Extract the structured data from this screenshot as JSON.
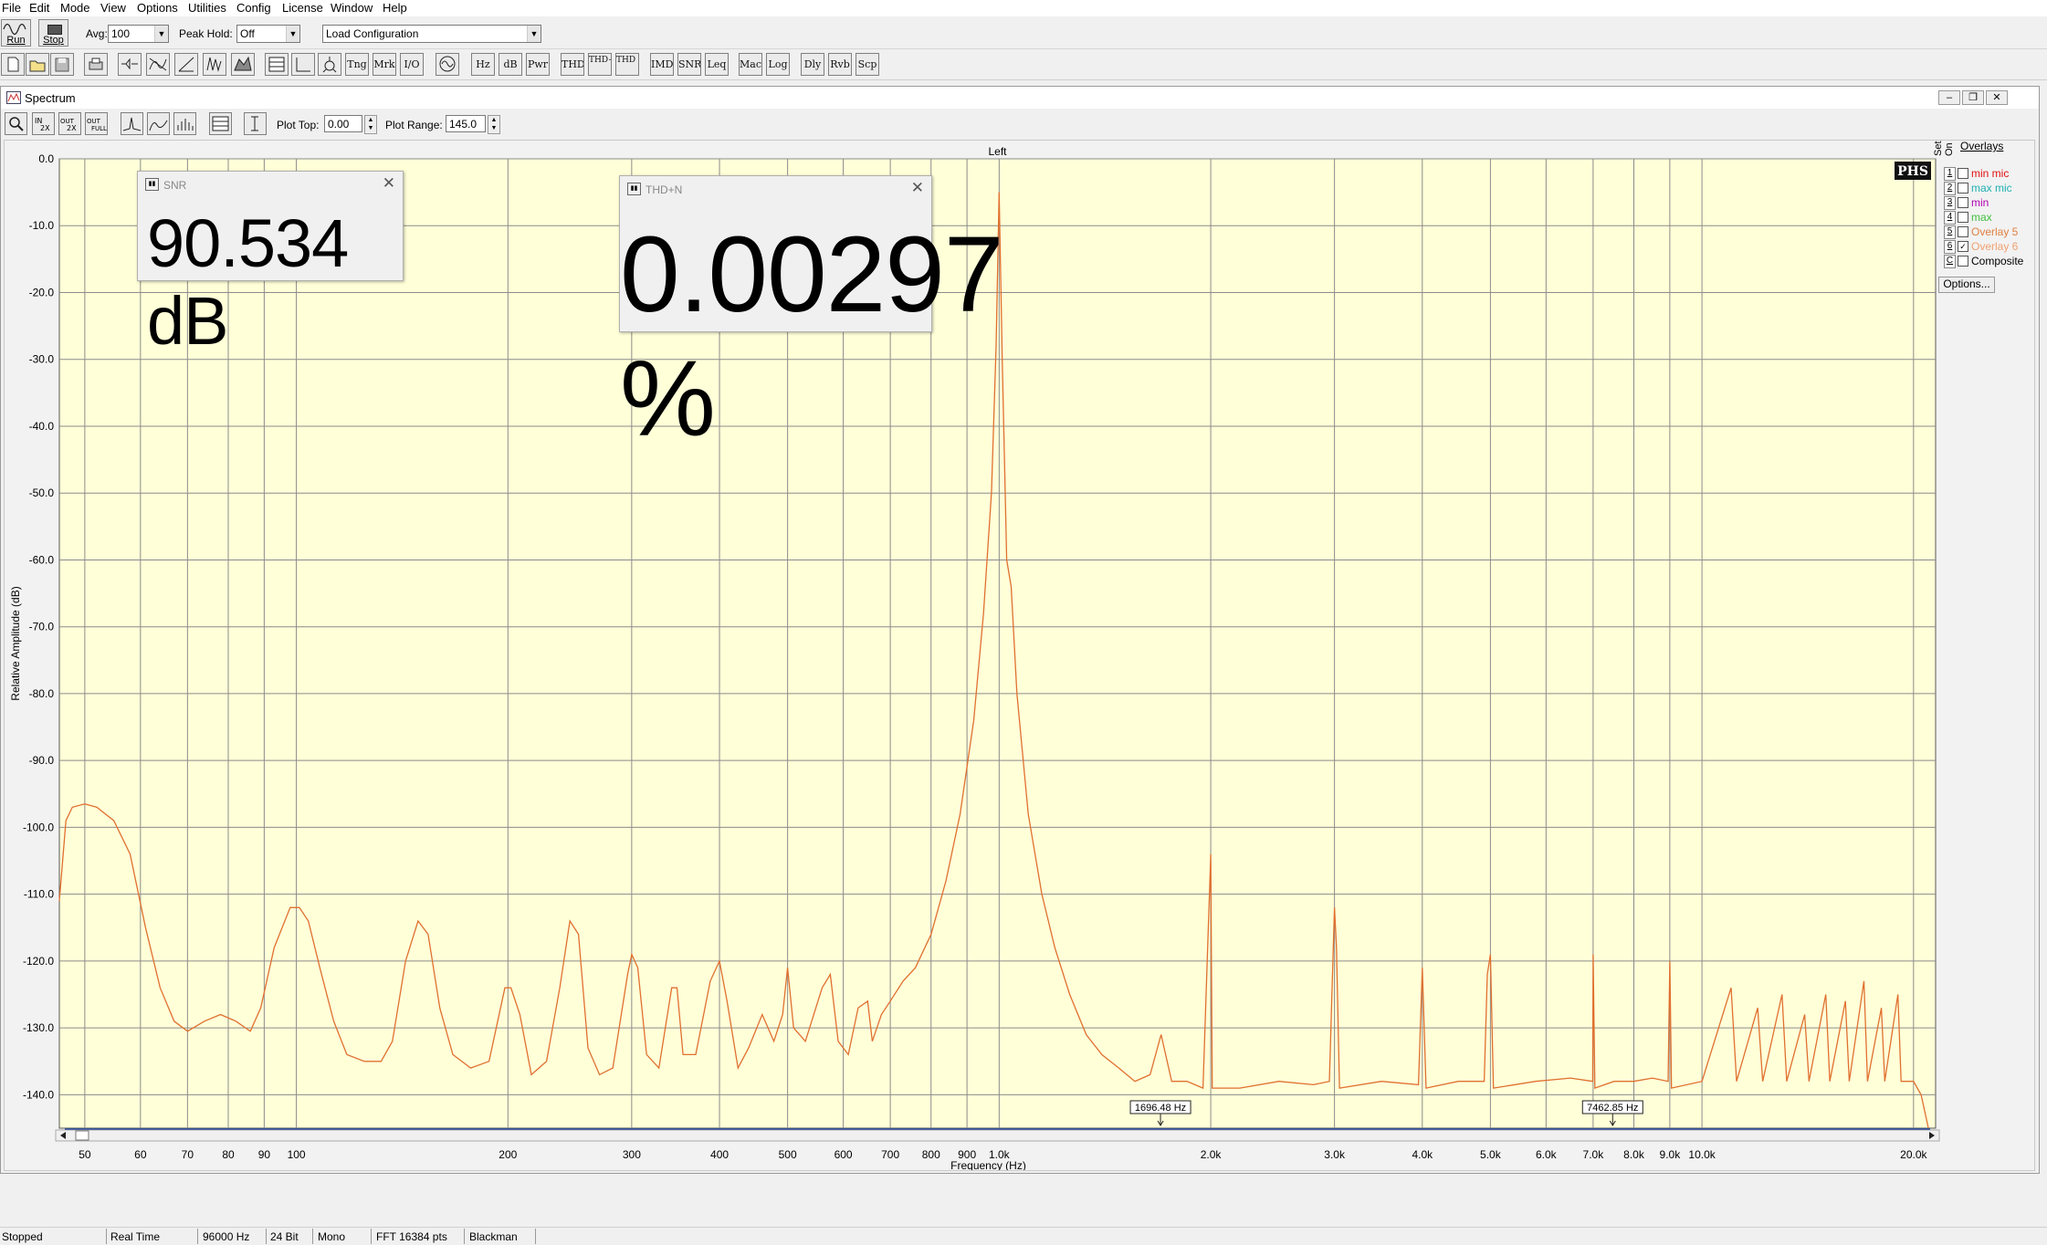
{
  "menu": [
    "File",
    "Edit",
    "Mode",
    "View",
    "Options",
    "Utilities",
    "Config",
    "License",
    "Window",
    "Help"
  ],
  "toolbar": {
    "run_label": "Run",
    "stop_label": "Stop",
    "avg_label": "Avg:",
    "avg_value": "100",
    "peak_hold_label": "Peak Hold:",
    "peak_hold_value": "Off",
    "config_value": "Load Configuration",
    "tool_buttons": [
      "Tng",
      "Mrk",
      "I/O",
      "Hz",
      "dB",
      "Pwr",
      "THD",
      "THD+N",
      "THD Freq",
      "IMD",
      "SNR",
      "Leq",
      "Mac",
      "Log",
      "Dly",
      "Rvb",
      "Scp"
    ]
  },
  "spectrum": {
    "title": "Spectrum",
    "plot_top_label": "Plot Top:",
    "plot_top_value": "0.00",
    "plot_range_label": "Plot Range:",
    "plot_range_value": "145.0",
    "channel_label": "Left",
    "logo": "PHS"
  },
  "overlays": {
    "title": "Overlays",
    "set_label": "Set",
    "on_label": "On",
    "items": [
      {
        "set": "1",
        "name": "min mic",
        "color": "#e01010",
        "checked": false
      },
      {
        "set": "2",
        "name": "max mic",
        "color": "#20b0b0",
        "checked": false
      },
      {
        "set": "3",
        "name": "min",
        "color": "#b000b0",
        "checked": false
      },
      {
        "set": "4",
        "name": "max",
        "color": "#40c040",
        "checked": false
      },
      {
        "set": "5",
        "name": "Overlay 5",
        "color": "#e08040",
        "checked": false
      },
      {
        "set": "6",
        "name": "Overlay 6",
        "color": "#f0a070",
        "checked": true
      },
      {
        "set": "C",
        "name": "Composite",
        "color": "#000000",
        "checked": false
      }
    ],
    "options_label": "Options..."
  },
  "meters": {
    "snr": {
      "title": "SNR",
      "value": "90.534 dB"
    },
    "thdn": {
      "title": "THD+N",
      "value": "0.00297 %"
    }
  },
  "markers": [
    {
      "label": "1696.48 Hz",
      "freq": 1696.48
    },
    {
      "label": "7462.85 Hz",
      "freq": 7462.85
    }
  ],
  "statusbar": [
    "Stopped",
    "Real Time",
    "96000 Hz",
    "24 Bit",
    "Mono",
    "FFT 16384 pts",
    "Blackman"
  ],
  "chart_data": {
    "type": "line",
    "xlabel": "Frequency (Hz)",
    "ylabel": "Relative Amplitude (dB)",
    "xscale": "log",
    "xlim": [
      46,
      21500
    ],
    "ylim": [
      -145,
      0
    ],
    "grid": true,
    "line_color": "#e07030",
    "background": "#ffffd8",
    "yticks": [
      "0.0",
      "-10.0",
      "-20.0",
      "-30.0",
      "-40.0",
      "-50.0",
      "-60.0",
      "-70.0",
      "-80.0",
      "-90.0",
      "-100.0",
      "-110.0",
      "-120.0",
      "-130.0",
      "-140.0"
    ],
    "xticks": [
      {
        "v": 50,
        "l": "50"
      },
      {
        "v": 60,
        "l": "60"
      },
      {
        "v": 70,
        "l": "70"
      },
      {
        "v": 80,
        "l": "80"
      },
      {
        "v": 90,
        "l": "90"
      },
      {
        "v": 100,
        "l": "100"
      },
      {
        "v": 200,
        "l": "200"
      },
      {
        "v": 300,
        "l": "300"
      },
      {
        "v": 400,
        "l": "400"
      },
      {
        "v": 500,
        "l": "500"
      },
      {
        "v": 600,
        "l": "600"
      },
      {
        "v": 700,
        "l": "700"
      },
      {
        "v": 800,
        "l": "800"
      },
      {
        "v": 900,
        "l": "900"
      },
      {
        "v": 1000,
        "l": "1.0k"
      },
      {
        "v": 2000,
        "l": "2.0k"
      },
      {
        "v": 3000,
        "l": "3.0k"
      },
      {
        "v": 4000,
        "l": "4.0k"
      },
      {
        "v": 5000,
        "l": "5.0k"
      },
      {
        "v": 6000,
        "l": "6.0k"
      },
      {
        "v": 7000,
        "l": "7.0k"
      },
      {
        "v": 8000,
        "l": "8.0k"
      },
      {
        "v": 9000,
        "l": "9.0k"
      },
      {
        "v": 10000,
        "l": "10.0k"
      },
      {
        "v": 20000,
        "l": "20.0k"
      }
    ],
    "series": [
      {
        "points": [
          [
            46,
            -111
          ],
          [
            47,
            -99
          ],
          [
            48,
            -97
          ],
          [
            50,
            -96.5
          ],
          [
            52,
            -97
          ],
          [
            55,
            -99
          ],
          [
            58,
            -104
          ],
          [
            61,
            -115
          ],
          [
            64,
            -124
          ],
          [
            67,
            -129
          ],
          [
            70,
            -130.5
          ],
          [
            74,
            -129
          ],
          [
            78,
            -128
          ],
          [
            82,
            -129
          ],
          [
            86,
            -130.5
          ],
          [
            89,
            -127
          ],
          [
            93,
            -118
          ],
          [
            98,
            -112
          ],
          [
            101,
            -112
          ],
          [
            104,
            -114
          ],
          [
            108,
            -121
          ],
          [
            113,
            -129
          ],
          [
            118,
            -134
          ],
          [
            125,
            -135
          ],
          [
            132,
            -135
          ],
          [
            137,
            -132
          ],
          [
            143,
            -120
          ],
          [
            149,
            -114
          ],
          [
            154,
            -116
          ],
          [
            160,
            -127
          ],
          [
            167,
            -134
          ],
          [
            177,
            -136
          ],
          [
            188,
            -135
          ],
          [
            198,
            -124
          ],
          [
            202,
            -124
          ],
          [
            208,
            -128
          ],
          [
            216,
            -137
          ],
          [
            227,
            -135
          ],
          [
            237,
            -124
          ],
          [
            245,
            -114
          ],
          [
            252,
            -116
          ],
          [
            260,
            -133
          ],
          [
            270,
            -137
          ],
          [
            282,
            -136
          ],
          [
            296,
            -122
          ],
          [
            300,
            -119
          ],
          [
            306,
            -121
          ],
          [
            315,
            -134
          ],
          [
            328,
            -136
          ],
          [
            342,
            -124
          ],
          [
            348,
            -124
          ],
          [
            355,
            -134
          ],
          [
            370,
            -134
          ],
          [
            388,
            -123
          ],
          [
            400,
            -120
          ],
          [
            410,
            -126
          ],
          [
            425,
            -136
          ],
          [
            440,
            -133
          ],
          [
            460,
            -128
          ],
          [
            478,
            -132
          ],
          [
            492,
            -128
          ],
          [
            500,
            -121
          ],
          [
            510,
            -130
          ],
          [
            530,
            -132
          ],
          [
            560,
            -124
          ],
          [
            575,
            -122
          ],
          [
            590,
            -132
          ],
          [
            610,
            -134
          ],
          [
            630,
            -127
          ],
          [
            650,
            -126
          ],
          [
            660,
            -132
          ],
          [
            680,
            -128
          ],
          [
            700,
            -126
          ],
          [
            730,
            -123
          ],
          [
            760,
            -121
          ],
          [
            800,
            -116
          ],
          [
            840,
            -108
          ],
          [
            880,
            -98
          ],
          [
            920,
            -84
          ],
          [
            950,
            -68
          ],
          [
            975,
            -50
          ],
          [
            990,
            -28
          ],
          [
            1000,
            -5
          ],
          [
            1010,
            -30
          ],
          [
            1025,
            -60
          ],
          [
            1040,
            -64
          ],
          [
            1060,
            -80
          ],
          [
            1100,
            -98
          ],
          [
            1150,
            -110
          ],
          [
            1200,
            -118
          ],
          [
            1260,
            -125
          ],
          [
            1330,
            -131
          ],
          [
            1400,
            -134
          ],
          [
            1480,
            -136
          ],
          [
            1560,
            -138
          ],
          [
            1640,
            -137
          ],
          [
            1700,
            -131
          ],
          [
            1760,
            -138
          ],
          [
            1850,
            -138
          ],
          [
            1950,
            -139
          ],
          [
            2000,
            -104
          ],
          [
            2010,
            -139
          ],
          [
            2200,
            -139
          ],
          [
            2500,
            -138
          ],
          [
            2800,
            -138.5
          ],
          [
            2950,
            -138
          ],
          [
            3000,
            -112
          ],
          [
            3020,
            -118
          ],
          [
            3050,
            -139
          ],
          [
            3500,
            -138
          ],
          [
            3950,
            -138.5
          ],
          [
            4000,
            -121
          ],
          [
            4050,
            -139
          ],
          [
            4500,
            -138
          ],
          [
            4900,
            -138
          ],
          [
            4950,
            -122
          ],
          [
            5000,
            -119
          ],
          [
            5050,
            -139
          ],
          [
            5800,
            -138
          ],
          [
            6500,
            -137.5
          ],
          [
            6990,
            -138
          ],
          [
            7000,
            -119
          ],
          [
            7040,
            -139
          ],
          [
            7500,
            -138
          ],
          [
            8000,
            -138
          ],
          [
            8500,
            -137.5
          ],
          [
            8950,
            -138
          ],
          [
            9000,
            -120
          ],
          [
            9050,
            -139
          ],
          [
            10000,
            -138
          ],
          [
            11000,
            -124
          ],
          [
            11200,
            -138
          ],
          [
            12000,
            -127
          ],
          [
            12200,
            -138
          ],
          [
            13000,
            -125
          ],
          [
            13200,
            -138
          ],
          [
            14000,
            -128
          ],
          [
            14200,
            -138
          ],
          [
            15000,
            -125
          ],
          [
            15200,
            -138
          ],
          [
            16000,
            -126
          ],
          [
            16200,
            -138
          ],
          [
            17000,
            -123
          ],
          [
            17200,
            -138
          ],
          [
            18000,
            -127
          ],
          [
            18200,
            -138
          ],
          [
            19000,
            -125
          ],
          [
            19200,
            -138
          ],
          [
            20000,
            -138
          ],
          [
            20500,
            -140
          ],
          [
            21000,
            -145
          ]
        ]
      }
    ]
  }
}
